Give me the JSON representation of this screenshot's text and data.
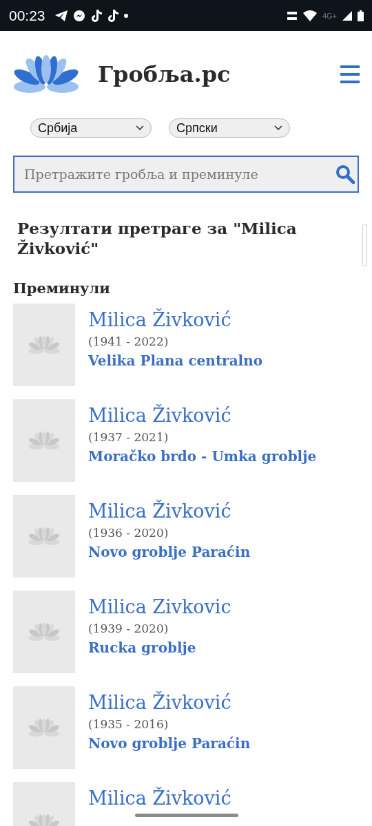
{
  "status_bar": {
    "time": "00:23",
    "network": "4G+"
  },
  "header": {
    "title": "Гробља.рс"
  },
  "filters": [
    "Србија",
    "Српски"
  ],
  "search": {
    "placeholder": "Претражите гробља и преминуле"
  },
  "results_heading": "Резултати претраге за \"Milica Živković\"",
  "section_title": "Преминули",
  "results": [
    {
      "name": "Milica Živković",
      "years": "(1941 - 2022)",
      "place": "Velika Plana centralno"
    },
    {
      "name": "Milica Živković",
      "years": "(1937 - 2021)",
      "place": "Moračko brdo - Umka groblje"
    },
    {
      "name": "Milica Živković",
      "years": "(1936 - 2020)",
      "place": "Novo groblje Paraćin"
    },
    {
      "name": "Milica Zivkovic",
      "years": "(1939 - 2020)",
      "place": "Rucka groblje"
    },
    {
      "name": "Milica Živković",
      "years": "(1935 - 2016)",
      "place": "Novo groblje Paraćin"
    },
    {
      "name": "Milica Živković"
    }
  ]
}
